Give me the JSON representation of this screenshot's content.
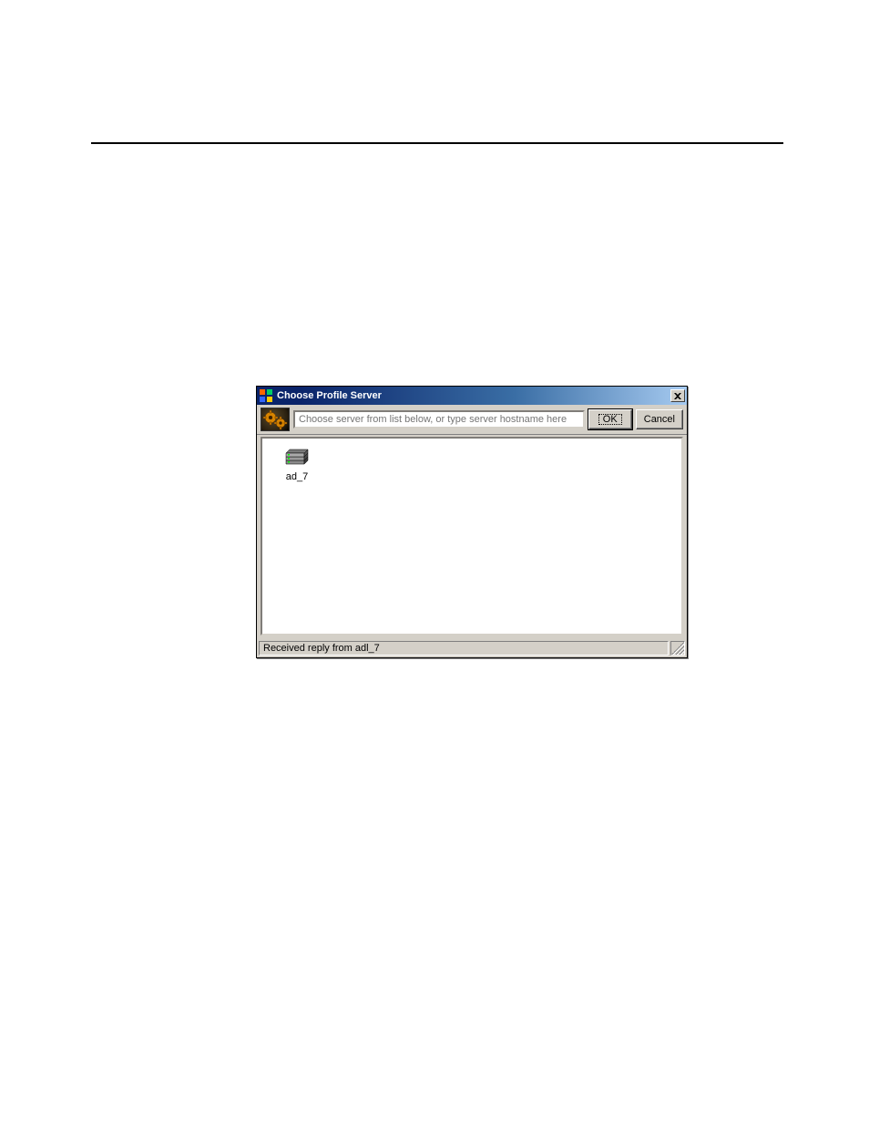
{
  "dialog": {
    "title": "Choose Profile Server",
    "input_placeholder": "Choose server from list below, or type server hostname here",
    "input_value": "",
    "ok_label": "OK",
    "cancel_label": "Cancel",
    "status_text": "Received reply from adl_7",
    "servers": [
      {
        "name": "ad_7"
      }
    ]
  }
}
